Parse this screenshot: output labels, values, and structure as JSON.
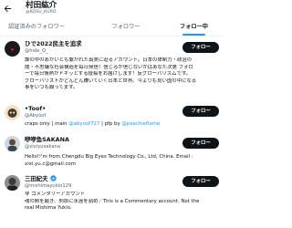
{
  "header": {
    "name": "村田紘介",
    "handle": "@KOSU_KURO"
  },
  "tabs": [
    {
      "label": "認証済みのフォロワー"
    },
    {
      "label": "フォロワー"
    },
    {
      "label": "フォロー中"
    }
  ],
  "users": [
    {
      "name": "ひで2022民主を追求",
      "handle": "@hide_Q_",
      "follow_label": "フォロー",
      "bio_lines": [
        "誰の中のあかいとも繋がれた真実に迫るアカウント。日本の体制力・政治の",
        "闇・不思議な社会構造を毎日発信！信じるか信じないかはあなた次第 フォロ",
        "ーで毎日情熱がドキッとする投稿をお届けします！反グローバリズムです。",
        "グローバリストがどんどん嫌いていく日本と世界。今よりも良い国の中になる",
        "事をいつも願ってます。"
      ]
    },
    {
      "name": "•Toof•",
      "handle": "@Abyoof",
      "follow_label": "フォロー",
      "bio_parts": [
        {
          "text": "craps only | main ",
          "link": false
        },
        {
          "text": "@abyoof727",
          "link": true
        },
        {
          "text": " | pfp by ",
          "link": false
        },
        {
          "text": "@peachieflame",
          "link": true
        }
      ]
    },
    {
      "name": "咿咿鱼SAKANA",
      "handle": "@xixiyusakana",
      "follow_label": "フォロー",
      "bio_lines": [
        "Hello!!'m from Chengdu Big Eyes Technology Co., Ltd, China. Email :",
        "xixi.yu.c@gmail.com"
      ]
    },
    {
      "name": "三田紀夫",
      "handle": "@mishimayukio129",
      "follow_label": "フォロー",
      "bio_lines": [
        "非 コメンタリーアカウント",
        "魂の剣を磨き、刹那に永遠を刻め／This is a Commentary account. Not the",
        "real Mishima Yukio."
      ]
    }
  ],
  "colors": {
    "accent": "#1d9bf0",
    "button": "#0f1419",
    "muted": "#536471"
  }
}
